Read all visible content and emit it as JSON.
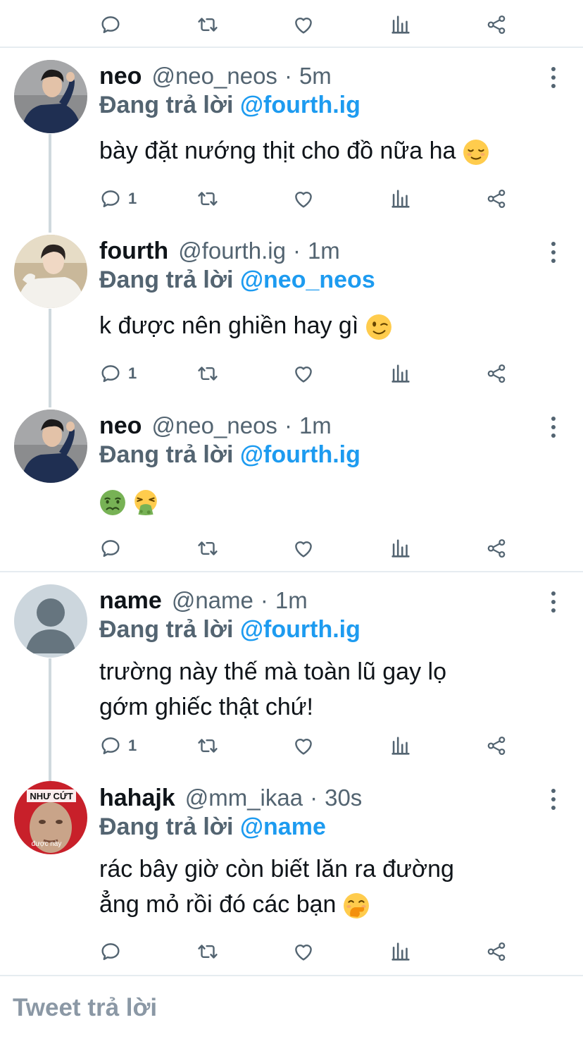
{
  "top_actions": {
    "reply_count": "",
    "retweet_count": "",
    "like_count": ""
  },
  "tweets": [
    {
      "name": "neo",
      "handle": "@neo_neos",
      "sep": "·",
      "time": "5m",
      "reply_prefix": "Đang trả lời",
      "reply_mention": "@fourth.ig",
      "text": "bày đặt nướng thịt cho đồ nữa ha",
      "emoji": [
        "relieved-face"
      ],
      "reply_count": "1"
    },
    {
      "name": "fourth",
      "handle": "@fourth.ig",
      "sep": "·",
      "time": "1m",
      "reply_prefix": "Đang trả lời",
      "reply_mention": "@neo_neos",
      "text": "k được nên ghiền hay gì",
      "emoji": [
        "winking-face"
      ],
      "reply_count": "1"
    },
    {
      "name": "neo",
      "handle": "@neo_neos",
      "sep": "·",
      "time": "1m",
      "reply_prefix": "Đang trả lời",
      "reply_mention": "@fourth.ig",
      "text": "",
      "emoji": [
        "nauseated-face",
        "vomiting-face"
      ],
      "reply_count": ""
    },
    {
      "name": "name",
      "handle": "@name",
      "sep": "·",
      "time": "1m",
      "reply_prefix": "Đang trả lời",
      "reply_mention": "@fourth.ig",
      "text_line1": "trường này thế mà toàn lũ gay lọ",
      "text_line2": "gớm ghiếc thật chứ!",
      "reply_count": "1"
    },
    {
      "name": "hahajk",
      "handle": "@mm_ikaa",
      "sep": "·",
      "time": "30s",
      "reply_prefix": "Đang trả lời",
      "reply_mention": "@name",
      "text_line1": "rác bây giờ còn biết lăn ra đường",
      "text_line2": "ẳng mỏ rồi đó các bạn",
      "emoji": [
        "face-with-hand-over-mouth"
      ],
      "reply_count": "",
      "avatar_text": {
        "line1": "NHƯ CỨT",
        "line2": "được này"
      }
    }
  ],
  "compose": {
    "placeholder": "Tweet trả lời"
  },
  "colors": {
    "mention": "#1d9bf0",
    "muted": "#536471",
    "divider": "#e6ecf0",
    "thread": "#cfd9de"
  }
}
